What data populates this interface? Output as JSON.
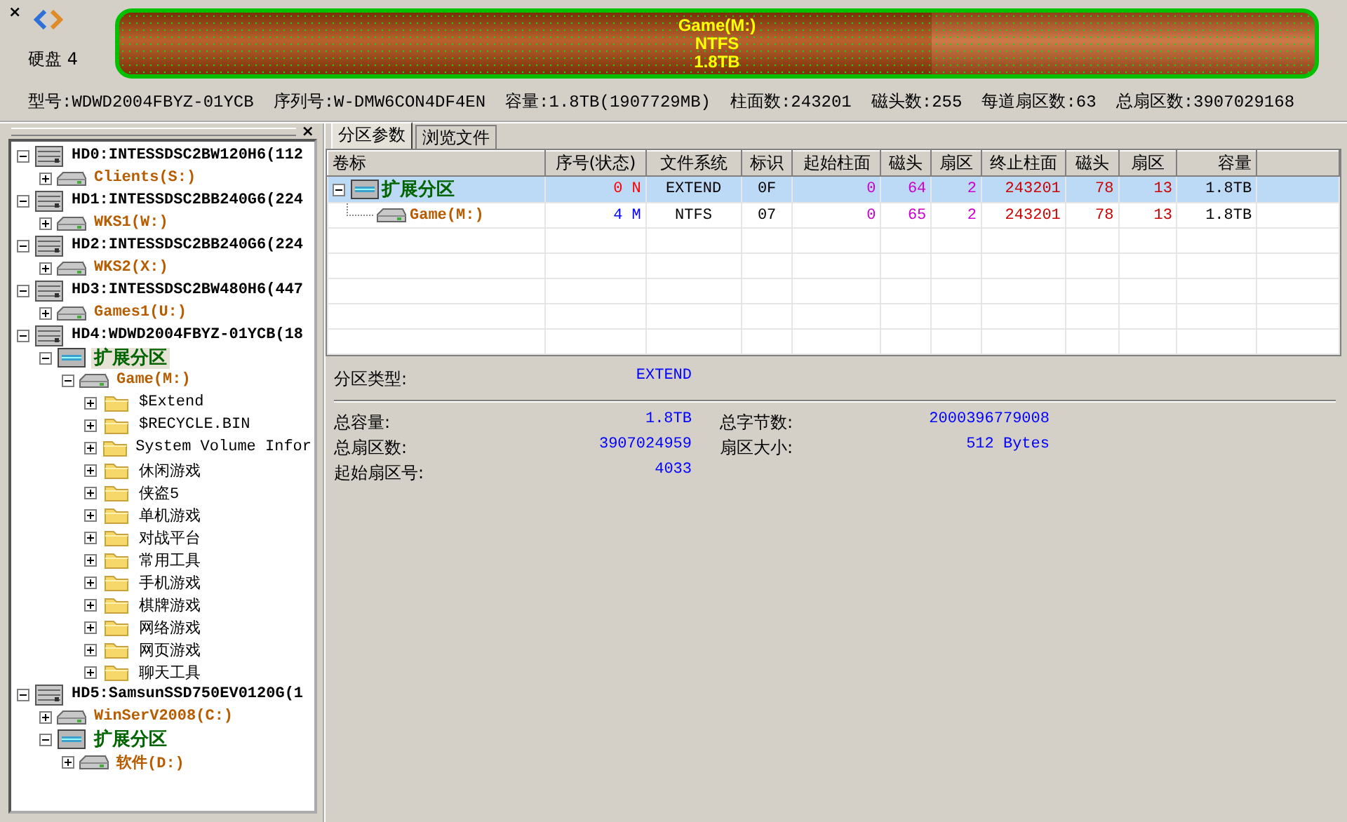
{
  "top": {
    "close": "×",
    "disk_label": "硬盘 4",
    "partition_bar": {
      "name": "Game(M:)",
      "filesystem": "NTFS",
      "size": "1.8TB",
      "level": 0.68
    },
    "disk_info": [
      "型号:WDWD2004FBYZ-01YCB",
      "序列号:W-DMW6CON4DF4EN",
      "容量:1.8TB(1907729MB)",
      "柱面数:243201",
      "磁头数:255",
      "每道扇区数:63",
      "总扇区数:3907029168"
    ]
  },
  "tree_panel": {
    "close": "×",
    "nodes": [
      {
        "kind": "disk",
        "label": "HD0:INTESSDSC2BW120H6(112",
        "expanded": true,
        "selected": false,
        "children": [
          {
            "kind": "volume",
            "label": "Clients(S:)",
            "expanded": false,
            "selected": false
          }
        ]
      },
      {
        "kind": "disk",
        "label": "HD1:INTESSDSC2BB240G6(224",
        "expanded": true,
        "selected": false,
        "children": [
          {
            "kind": "volume",
            "label": "WKS1(W:)",
            "expanded": false,
            "selected": false
          }
        ]
      },
      {
        "kind": "disk",
        "label": "HD2:INTESSDSC2BB240G6(224",
        "expanded": true,
        "selected": false,
        "children": [
          {
            "kind": "volume",
            "label": "WKS2(X:)",
            "expanded": false,
            "selected": false
          }
        ]
      },
      {
        "kind": "disk",
        "label": "HD3:INTESSDSC2BW480H6(447",
        "expanded": true,
        "selected": false,
        "children": [
          {
            "kind": "volume",
            "label": "Games1(U:)",
            "expanded": false,
            "selected": false
          }
        ]
      },
      {
        "kind": "disk",
        "label": "HD4:WDWD2004FBYZ-01YCB(18",
        "expanded": true,
        "selected": false,
        "children": [
          {
            "kind": "extended",
            "label": "扩展分区",
            "expanded": true,
            "selected": true,
            "children": [
              {
                "kind": "volume",
                "label": "Game(M:)",
                "expanded": true,
                "selected": false,
                "children": [
                  {
                    "kind": "folder",
                    "label": "$Extend",
                    "expanded": false,
                    "selected": false
                  },
                  {
                    "kind": "folder",
                    "label": "$RECYCLE.BIN",
                    "expanded": false,
                    "selected": false
                  },
                  {
                    "kind": "folder",
                    "label": "System Volume Infor",
                    "expanded": false,
                    "selected": false
                  },
                  {
                    "kind": "folder",
                    "label": "休闲游戏",
                    "expanded": false,
                    "selected": false
                  },
                  {
                    "kind": "folder",
                    "label": "侠盗5",
                    "expanded": false,
                    "selected": false
                  },
                  {
                    "kind": "folder",
                    "label": "单机游戏",
                    "expanded": false,
                    "selected": false
                  },
                  {
                    "kind": "folder",
                    "label": "对战平台",
                    "expanded": false,
                    "selected": false
                  },
                  {
                    "kind": "folder",
                    "label": "常用工具",
                    "expanded": false,
                    "selected": false
                  },
                  {
                    "kind": "folder",
                    "label": "手机游戏",
                    "expanded": false,
                    "selected": false
                  },
                  {
                    "kind": "folder",
                    "label": "棋牌游戏",
                    "expanded": false,
                    "selected": false
                  },
                  {
                    "kind": "folder",
                    "label": "网络游戏",
                    "expanded": false,
                    "selected": false
                  },
                  {
                    "kind": "folder",
                    "label": "网页游戏",
                    "expanded": false,
                    "selected": false
                  },
                  {
                    "kind": "folder",
                    "label": "聊天工具",
                    "expanded": false,
                    "selected": false
                  }
                ]
              }
            ]
          }
        ]
      },
      {
        "kind": "disk",
        "label": "HD5:SamsunSSD750EV0120G(1",
        "expanded": true,
        "selected": false,
        "children": [
          {
            "kind": "volume",
            "label": "WinSerV2008(C:)",
            "expanded": false,
            "selected": false
          },
          {
            "kind": "extended",
            "label": "扩展分区",
            "expanded": true,
            "selected": false,
            "children": [
              {
                "kind": "volume",
                "label": "软件(D:)",
                "expanded": false,
                "selected": false
              }
            ]
          }
        ]
      }
    ]
  },
  "tabs": [
    {
      "label": "分区参数",
      "selected": true
    },
    {
      "label": "浏览文件",
      "selected": false
    }
  ],
  "table": {
    "columns": [
      "卷标",
      "序号(状态)",
      "文件系统",
      "标识",
      "起始柱面",
      "磁头",
      "扇区",
      "终止柱面",
      "磁头",
      "扇区",
      "容量"
    ],
    "rows": [
      {
        "kind": "extended",
        "selected": true,
        "expanded": true,
        "color": "#ff0000",
        "cells": [
          "扩展分区",
          "0 N",
          "EXTEND",
          "0F",
          "0",
          "64",
          "2",
          "243201",
          "78",
          "13",
          "1.8TB"
        ]
      },
      {
        "kind": "volume",
        "selected": false,
        "color": "#0000ff",
        "cells": [
          "Game(M:)",
          "4 M",
          "NTFS",
          "07",
          "0",
          "65",
          "2",
          "243201",
          "78",
          "13",
          "1.8TB"
        ]
      }
    ]
  },
  "details": {
    "type_label": "分区类型:",
    "type_value": "EXTEND",
    "fields": [
      {
        "label": "总容量:",
        "value": "1.8TB"
      },
      {
        "label": "总字节数:",
        "value": "2000396779008"
      },
      {
        "label": "总扇区数:",
        "value": "3907024959"
      },
      {
        "label": "扇区大小:",
        "value": "512 Bytes"
      },
      {
        "label": "起始扇区号:",
        "value": "4033"
      }
    ]
  }
}
